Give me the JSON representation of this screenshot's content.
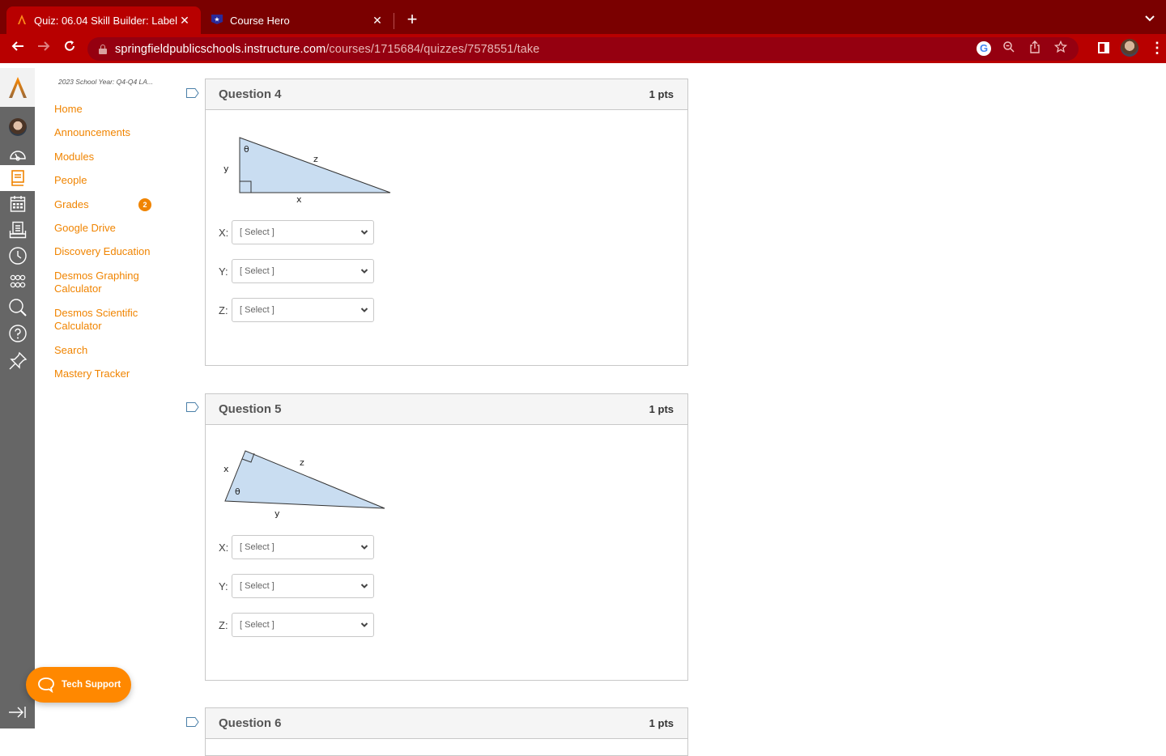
{
  "browser": {
    "tabs": [
      {
        "title": "Quiz: 06.04 Skill Builder: Label",
        "icon": "canvas-logo-icon",
        "active": true
      },
      {
        "title": "Course Hero",
        "icon": "course-hero-icon",
        "active": false
      }
    ],
    "new_tab_label": "+",
    "url_domain": "springfieldpublicschools.instructure.com",
    "url_path": "/courses/1715684/quizzes/7578551/take",
    "colors": {
      "tabbar": "#7a0000",
      "toolbar": "#b80000",
      "omnibox": "#950010"
    }
  },
  "global_nav": {
    "items": [
      {
        "name": "account",
        "icon": "avatar-icon"
      },
      {
        "name": "dashboard",
        "icon": "dashboard-gauge-icon"
      },
      {
        "name": "courses",
        "icon": "courses-book-icon",
        "active": true
      },
      {
        "name": "calendar",
        "icon": "calendar-icon"
      },
      {
        "name": "inbox",
        "icon": "inbox-icon"
      },
      {
        "name": "history",
        "icon": "clock-icon"
      },
      {
        "name": "commons",
        "icon": "commons-icon"
      },
      {
        "name": "search",
        "icon": "search-icon"
      },
      {
        "name": "help",
        "icon": "help-icon"
      },
      {
        "name": "pin",
        "icon": "pin-icon"
      }
    ]
  },
  "course_nav": {
    "course_title": "2023 School Year: Q4-Q4 LA...",
    "items": [
      {
        "label": "Home"
      },
      {
        "label": "Announcements"
      },
      {
        "label": "Modules"
      },
      {
        "label": "People"
      },
      {
        "label": "Grades",
        "badge": "2"
      },
      {
        "label": "Google Drive"
      },
      {
        "label": "Discovery Education"
      },
      {
        "label": "Desmos Graphing Calculator"
      },
      {
        "label": "Desmos Scientific Calculator"
      },
      {
        "label": "Search"
      },
      {
        "label": "Mastery Tracker"
      }
    ],
    "accent_color": "#f08400"
  },
  "questions": [
    {
      "title": "Question 4",
      "points": "1 pts",
      "diagram_labels": {
        "theta": "θ",
        "hyp": "z",
        "vertical": "y",
        "horizontal": "x"
      },
      "selects": [
        {
          "label": "X:",
          "value": "[ Select ]"
        },
        {
          "label": "Y:",
          "value": "[ Select ]"
        },
        {
          "label": "Z:",
          "value": "[ Select ]"
        }
      ]
    },
    {
      "title": "Question 5",
      "points": "1 pts",
      "diagram_labels": {
        "theta": "θ",
        "hyp": "z",
        "short_leg": "x",
        "long_side": "y"
      },
      "selects": [
        {
          "label": "X:",
          "value": "[ Select ]"
        },
        {
          "label": "Y:",
          "value": "[ Select ]"
        },
        {
          "label": "Z:",
          "value": "[ Select ]"
        }
      ]
    },
    {
      "title": "Question 6",
      "points": "1 pts"
    }
  ],
  "tech_support": {
    "label": "Tech Support",
    "color": "#ff8800"
  }
}
